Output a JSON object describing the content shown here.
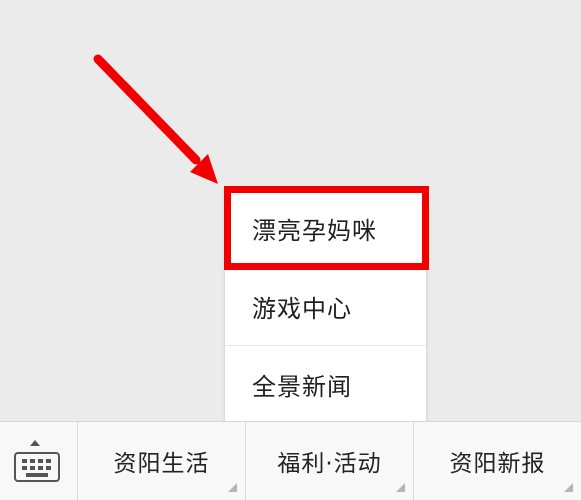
{
  "popup_menu": {
    "items": [
      {
        "label": "漂亮孕妈咪"
      },
      {
        "label": "游戏中心"
      },
      {
        "label": "全景新闻"
      }
    ]
  },
  "bottom_bar": {
    "keyboard_icon": "keyboard-icon",
    "tabs": [
      {
        "label": "资阳生活"
      },
      {
        "label": "福利·活动"
      },
      {
        "label": "资阳新报"
      }
    ]
  },
  "annotation": {
    "color": "#f20000"
  }
}
